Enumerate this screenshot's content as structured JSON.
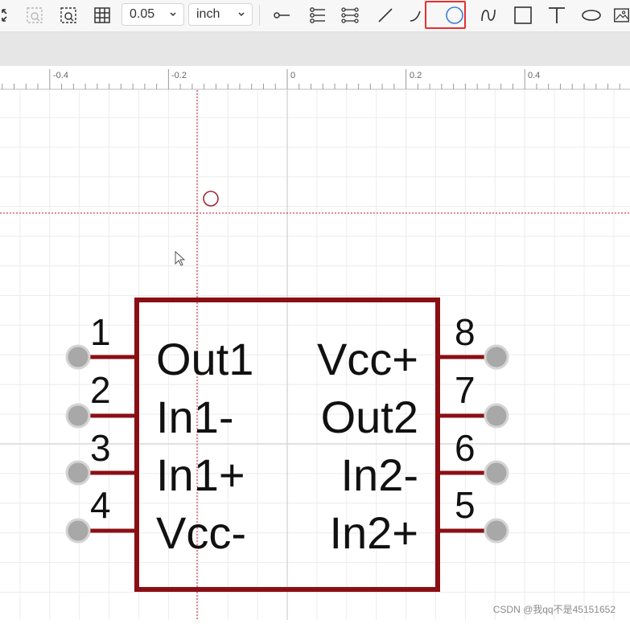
{
  "toolbar": {
    "grid_size": "0.05",
    "unit": "inch",
    "icons": [
      "arrows-icon",
      "zoom-area-icon",
      "zoom-select-icon",
      "grid-icon",
      "pin-icon",
      "pin-list-icon",
      "pin-array-icon",
      "line-icon",
      "arc-icon",
      "circle-icon",
      "bezier-icon",
      "rectangle-icon",
      "text-icon",
      "ellipse-icon",
      "image-icon"
    ],
    "active_tool": "circle-icon"
  },
  "ruler": {
    "labels": [
      "-0.4",
      "-0.2",
      "0",
      "0.2",
      "0.4"
    ]
  },
  "component": {
    "left_pins": [
      {
        "number": "1",
        "label": "Out1"
      },
      {
        "number": "2",
        "label": "In1-"
      },
      {
        "number": "3",
        "label": "In1+"
      },
      {
        "number": "4",
        "label": "Vcc-"
      }
    ],
    "right_pins": [
      {
        "number": "8",
        "label": "Vcc+"
      },
      {
        "number": "7",
        "label": "Out2"
      },
      {
        "number": "6",
        "label": "In2-"
      },
      {
        "number": "5",
        "label": "In2+"
      }
    ]
  },
  "watermark": "CSDN @我qq不是45151652",
  "colors": {
    "body_outline": "#8a0f14",
    "pin_line": "#8a0f14",
    "pin_dot": "#9a9a9a",
    "grid": "#ececec",
    "crosshair": "#c0182b",
    "highlight": "#e53030"
  }
}
